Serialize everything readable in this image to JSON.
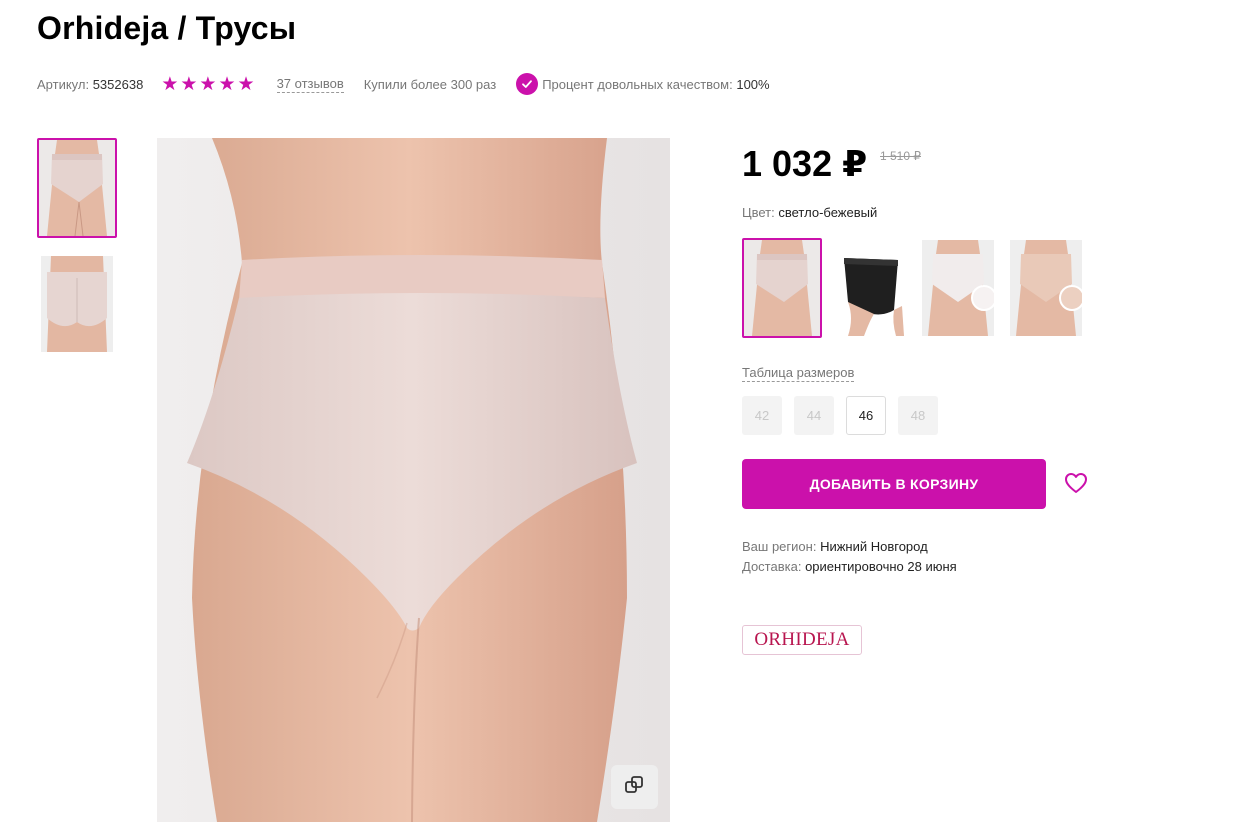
{
  "product": {
    "title": "Orhideja / Трусы",
    "article_label": "Артикул:",
    "article_value": "5352638",
    "rating": 5,
    "reviews_text": "37 отзывов",
    "bought_text": "Купили более 300 раз",
    "quality_label": "Процент довольных качеством:",
    "quality_value": "100%"
  },
  "price": {
    "current": "1 032 ₽",
    "old": "1 510 ₽"
  },
  "color": {
    "label": "Цвет:",
    "value": "светло-бежевый"
  },
  "sizes": {
    "table_link": "Таблица размеров",
    "options": [
      "42",
      "44",
      "46",
      "48"
    ],
    "available": [
      "46"
    ]
  },
  "actions": {
    "add_to_cart": "ДОБАВИТЬ В КОРЗИНУ"
  },
  "delivery": {
    "region_label": "Ваш регион:",
    "region_value": "Нижний Новгород",
    "delivery_label": "Доставка:",
    "delivery_value": "ориентировочно 28 июня"
  },
  "brand": {
    "logo_text": "ORHIDEJA"
  },
  "colors": {
    "accent": "#cb11ab",
    "disabled_bg": "#f3f3f3"
  },
  "icons": {
    "rating": "star-icon",
    "quality": "check-circle-icon",
    "zoom": "copy-zoom-icon",
    "favorite": "heart-icon"
  }
}
